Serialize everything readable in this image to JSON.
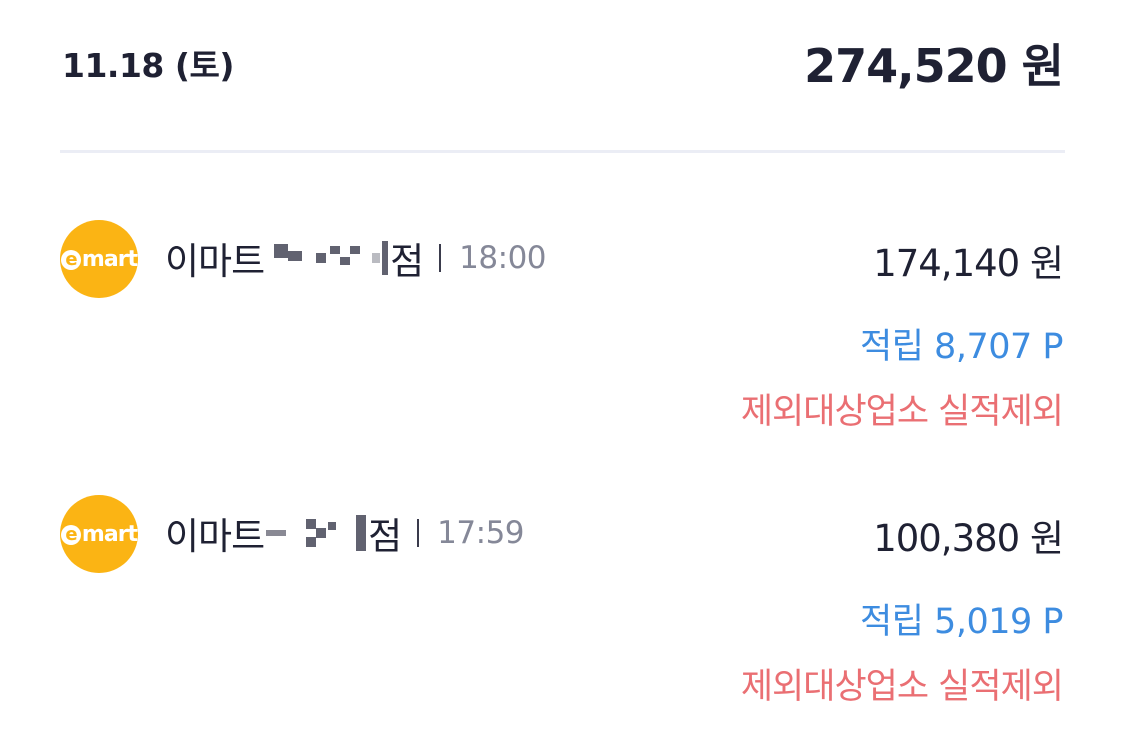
{
  "day": {
    "date": "11.18 (토)",
    "total": "274,520 원"
  },
  "transactions": [
    {
      "logo_label": "mart",
      "logo_initial": "e",
      "merchant_prefix": "이마트",
      "merchant_suffix": "점",
      "time": "18:00",
      "amount": "174,140 원",
      "points": "적립 8,707 P",
      "note": "제외대상업소 실적제외"
    },
    {
      "logo_label": "mart",
      "logo_initial": "e",
      "merchant_prefix": "이마트",
      "merchant_suffix": "점",
      "time": "17:59",
      "amount": "100,380 원",
      "points": "적립 5,019 P",
      "note": "제외대상업소 실적제외"
    }
  ],
  "colors": {
    "brand_logo": "#fbb414",
    "points": "#3d8ce0",
    "note": "#ea6f73",
    "text": "#1f2133",
    "muted": "#858898",
    "divider": "#ebedf5"
  },
  "icons": {
    "merchant_logo": "emart-logo-icon"
  }
}
